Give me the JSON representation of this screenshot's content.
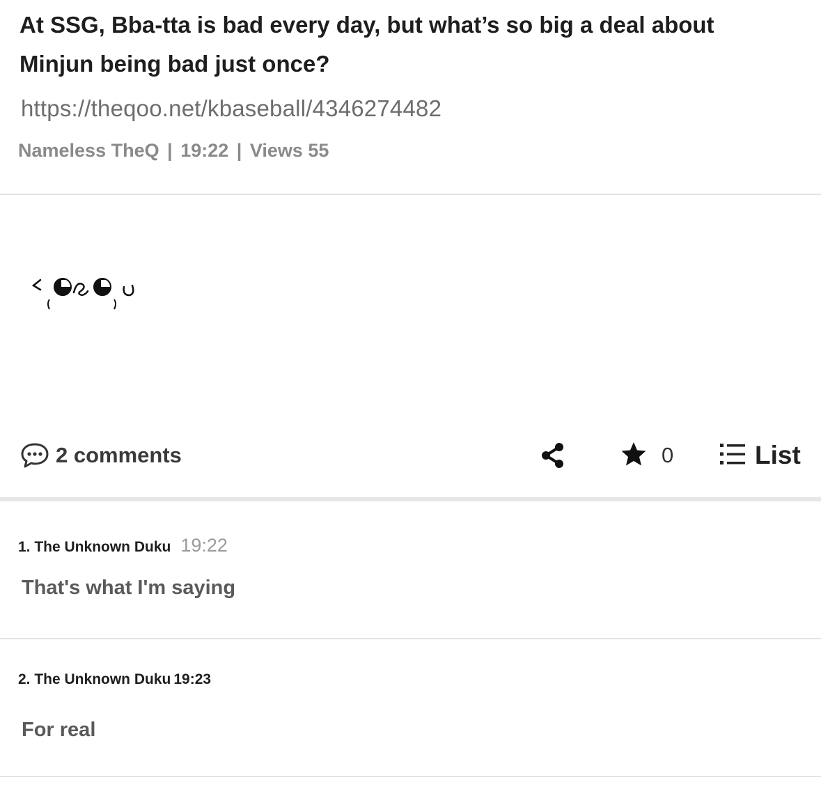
{
  "post": {
    "title": "At SSG, Bba-tta is bad every day, but what’s so big a deal about Minjun being bad just once?",
    "url": "https://theqoo.net/kbaseball/4346274482",
    "author": "Nameless TheQ",
    "time": "19:22",
    "views": "Views 55",
    "separator": "|"
  },
  "body": {
    "emoticon_icon": "kaomoji-face-icon"
  },
  "actions": {
    "comments_label": "2 comments",
    "comments_icon": "speech-bubble-icon",
    "share_icon": "share-icon",
    "star_icon": "star-icon",
    "star_count": "0",
    "list_icon": "list-icon",
    "list_label": "List"
  },
  "comments": [
    {
      "author": "1. The Unknown Duku",
      "time": "19:22",
      "text": "That's what I'm saying"
    },
    {
      "author": "2. The Unknown Duku",
      "time": "19:23",
      "text": "For real"
    }
  ],
  "colors": {
    "title": "#1e1e1e",
    "url": "#6d6d6d",
    "meta": "#8a8a8a",
    "divider": "#e3e3e3",
    "comment_time": "#9a9a9a",
    "comment_text": "#5a5a5a"
  }
}
